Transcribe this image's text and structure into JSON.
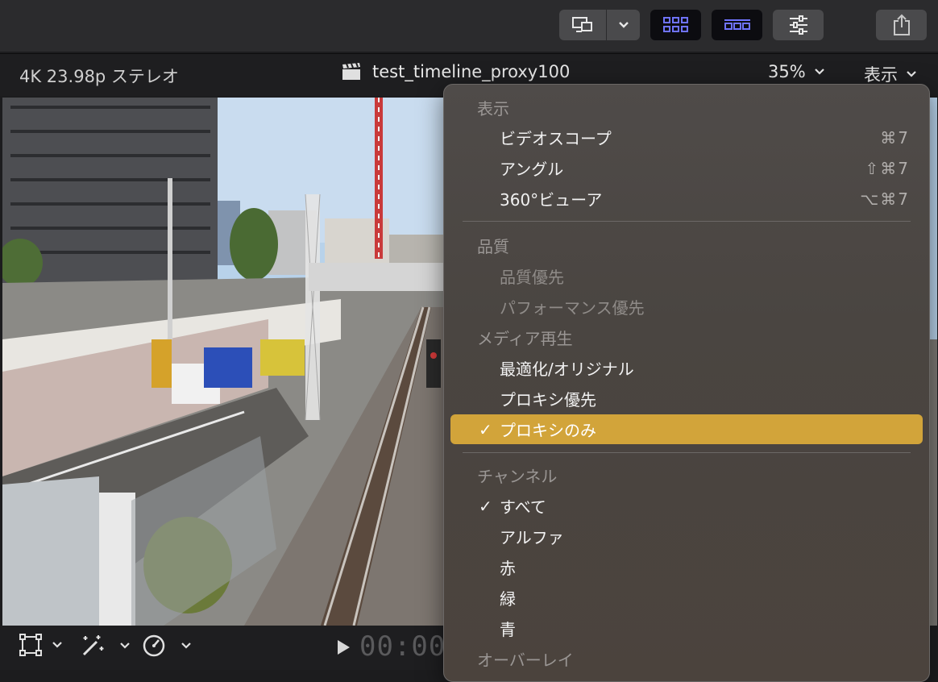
{
  "toolbar": {
    "buttons": [
      "display-icon",
      "chevron-down-icon",
      "browser-grid-icon",
      "timeline-icon",
      "inspector-sliders-icon",
      "share-icon"
    ]
  },
  "viewer": {
    "format": "4K 23.98p ステレオ",
    "clip_title": "test_timeline_proxy100",
    "zoom": "35%",
    "view_menu": "表示"
  },
  "bottom": {
    "timecode": "00:00:"
  },
  "menu": {
    "sections": {
      "view": "表示",
      "quality": "品質",
      "media_playback": "メディア再生",
      "channels": "チャンネル",
      "overlay": "オーバーレイ"
    },
    "items": {
      "video_scopes": {
        "label": "ビデオスコープ",
        "shortcut": "⌘7"
      },
      "angles": {
        "label": "アングル",
        "shortcut": "⇧⌘7"
      },
      "viewer_360": {
        "label": "360°ビューア",
        "shortcut": "⌥⌘7"
      },
      "quality_first": {
        "label": "品質優先"
      },
      "performance_first": {
        "label": "パフォーマンス優先"
      },
      "optimized_original": {
        "label": "最適化/オリジナル"
      },
      "proxy_preferred": {
        "label": "プロキシ優先"
      },
      "proxy_only": {
        "label": "プロキシのみ",
        "check": "✓"
      },
      "all": {
        "label": "すべて",
        "check": "✓"
      },
      "alpha": {
        "label": "アルファ"
      },
      "red": {
        "label": "赤"
      },
      "green": {
        "label": "緑"
      },
      "blue": {
        "label": "青"
      }
    }
  },
  "colors": {
    "accent_selected": "#d2a43a",
    "toolbar_active_icon": "#6f73ff"
  }
}
